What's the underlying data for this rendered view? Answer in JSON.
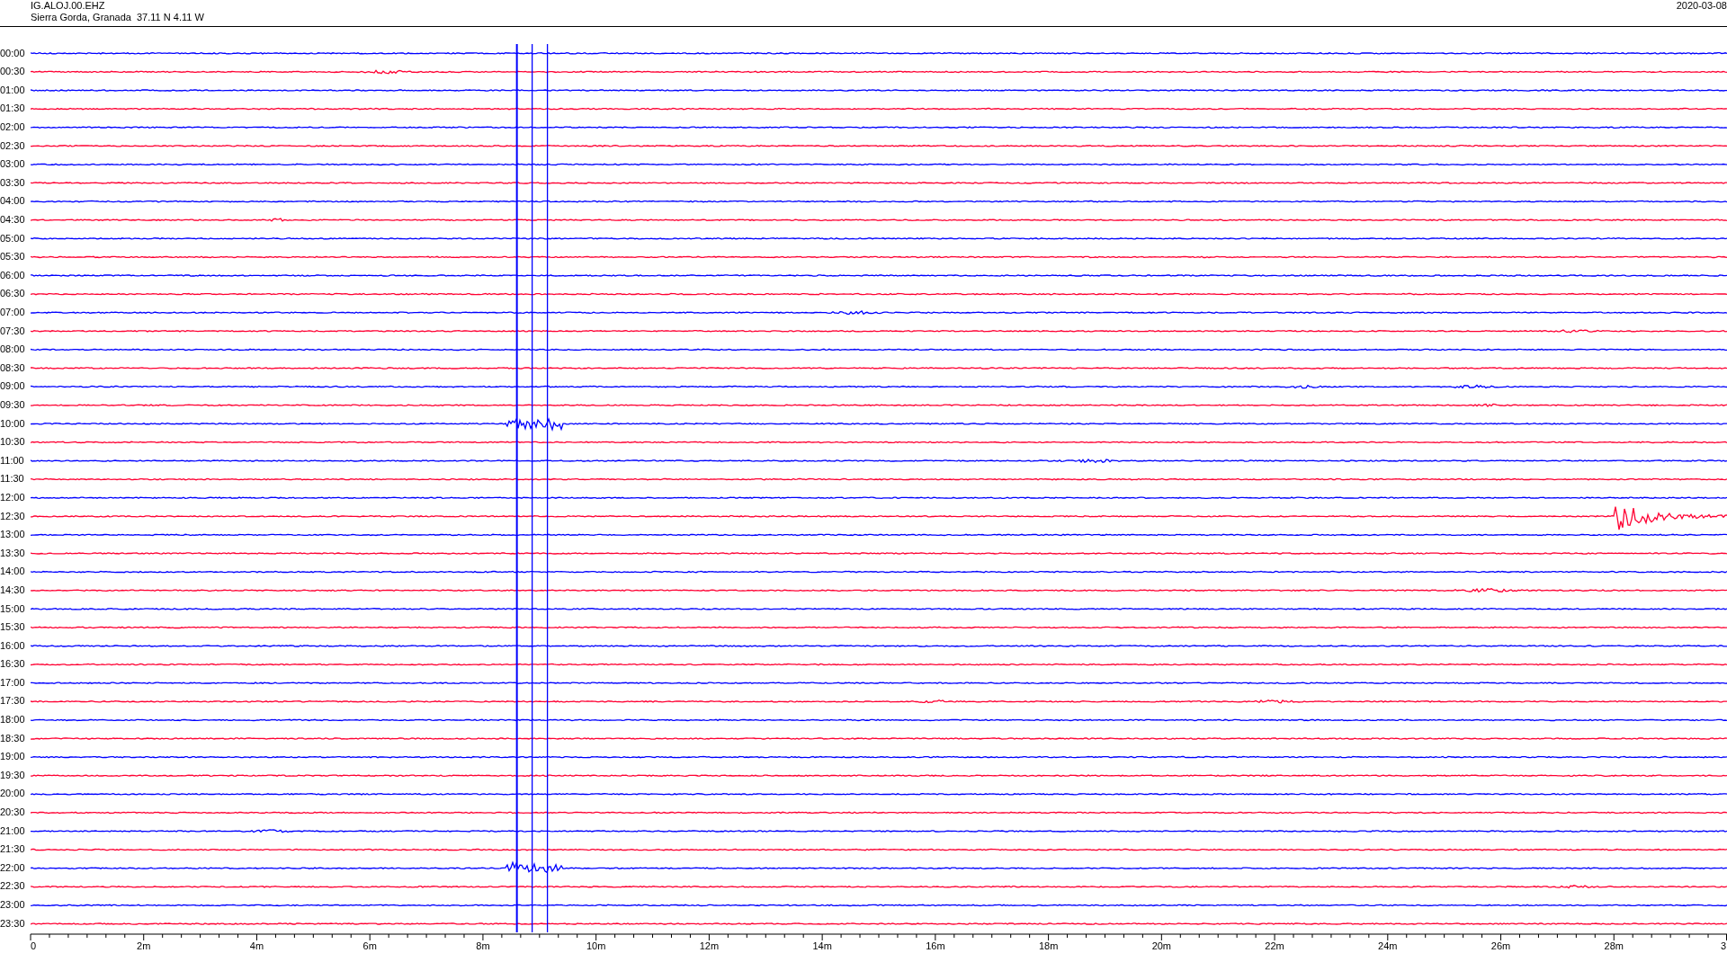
{
  "header": {
    "station": "IG.ALOJ.00.EHZ",
    "location": "Sierra Gorda, Granada  37.11 N 4.11 W",
    "date": "2020-03-08"
  },
  "rows": [
    {
      "label": "00:00",
      "color": "#0000ff"
    },
    {
      "label": "00:30",
      "color": "#ff0033"
    },
    {
      "label": "01:00",
      "color": "#0000ff"
    },
    {
      "label": "01:30",
      "color": "#ff0033"
    },
    {
      "label": "02:00",
      "color": "#0000ff"
    },
    {
      "label": "02:30",
      "color": "#ff0033"
    },
    {
      "label": "03:00",
      "color": "#0000ff"
    },
    {
      "label": "03:30",
      "color": "#ff0033"
    },
    {
      "label": "04:00",
      "color": "#0000ff"
    },
    {
      "label": "04:30",
      "color": "#ff0033"
    },
    {
      "label": "05:00",
      "color": "#0000ff"
    },
    {
      "label": "05:30",
      "color": "#ff0033"
    },
    {
      "label": "06:00",
      "color": "#0000ff"
    },
    {
      "label": "06:30",
      "color": "#ff0033"
    },
    {
      "label": "07:00",
      "color": "#0000ff"
    },
    {
      "label": "07:30",
      "color": "#ff0033"
    },
    {
      "label": "08:00",
      "color": "#0000ff"
    },
    {
      "label": "08:30",
      "color": "#ff0033"
    },
    {
      "label": "09:00",
      "color": "#0000ff"
    },
    {
      "label": "09:30",
      "color": "#ff0033"
    },
    {
      "label": "10:00",
      "color": "#0000ff"
    },
    {
      "label": "10:30",
      "color": "#ff0033"
    },
    {
      "label": "11:00",
      "color": "#0000ff"
    },
    {
      "label": "11:30",
      "color": "#ff0033"
    },
    {
      "label": "12:00",
      "color": "#0000ff"
    },
    {
      "label": "12:30",
      "color": "#ff0033"
    },
    {
      "label": "13:00",
      "color": "#0000ff"
    },
    {
      "label": "13:30",
      "color": "#ff0033"
    },
    {
      "label": "14:00",
      "color": "#0000ff"
    },
    {
      "label": "14:30",
      "color": "#ff0033"
    },
    {
      "label": "15:00",
      "color": "#0000ff"
    },
    {
      "label": "15:30",
      "color": "#ff0033"
    },
    {
      "label": "16:00",
      "color": "#0000ff"
    },
    {
      "label": "16:30",
      "color": "#ff0033"
    },
    {
      "label": "17:00",
      "color": "#0000ff"
    },
    {
      "label": "17:30",
      "color": "#ff0033"
    },
    {
      "label": "18:00",
      "color": "#0000ff"
    },
    {
      "label": "18:30",
      "color": "#ff0033"
    },
    {
      "label": "19:00",
      "color": "#0000ff"
    },
    {
      "label": "19:30",
      "color": "#ff0033"
    },
    {
      "label": "20:00",
      "color": "#0000ff"
    },
    {
      "label": "20:30",
      "color": "#ff0033"
    },
    {
      "label": "21:00",
      "color": "#0000ff"
    },
    {
      "label": "21:30",
      "color": "#ff0033"
    },
    {
      "label": "22:00",
      "color": "#0000ff"
    },
    {
      "label": "22:30",
      "color": "#ff0033"
    },
    {
      "label": "23:00",
      "color": "#0000ff"
    },
    {
      "label": "23:30",
      "color": "#ff0033"
    }
  ],
  "axis": {
    "labels": [
      "0",
      "2m",
      "4m",
      "6m",
      "8m",
      "10m",
      "12m",
      "14m",
      "16m",
      "18m",
      "20m",
      "22m",
      "24m",
      "26m",
      "28m",
      "3"
    ]
  }
}
